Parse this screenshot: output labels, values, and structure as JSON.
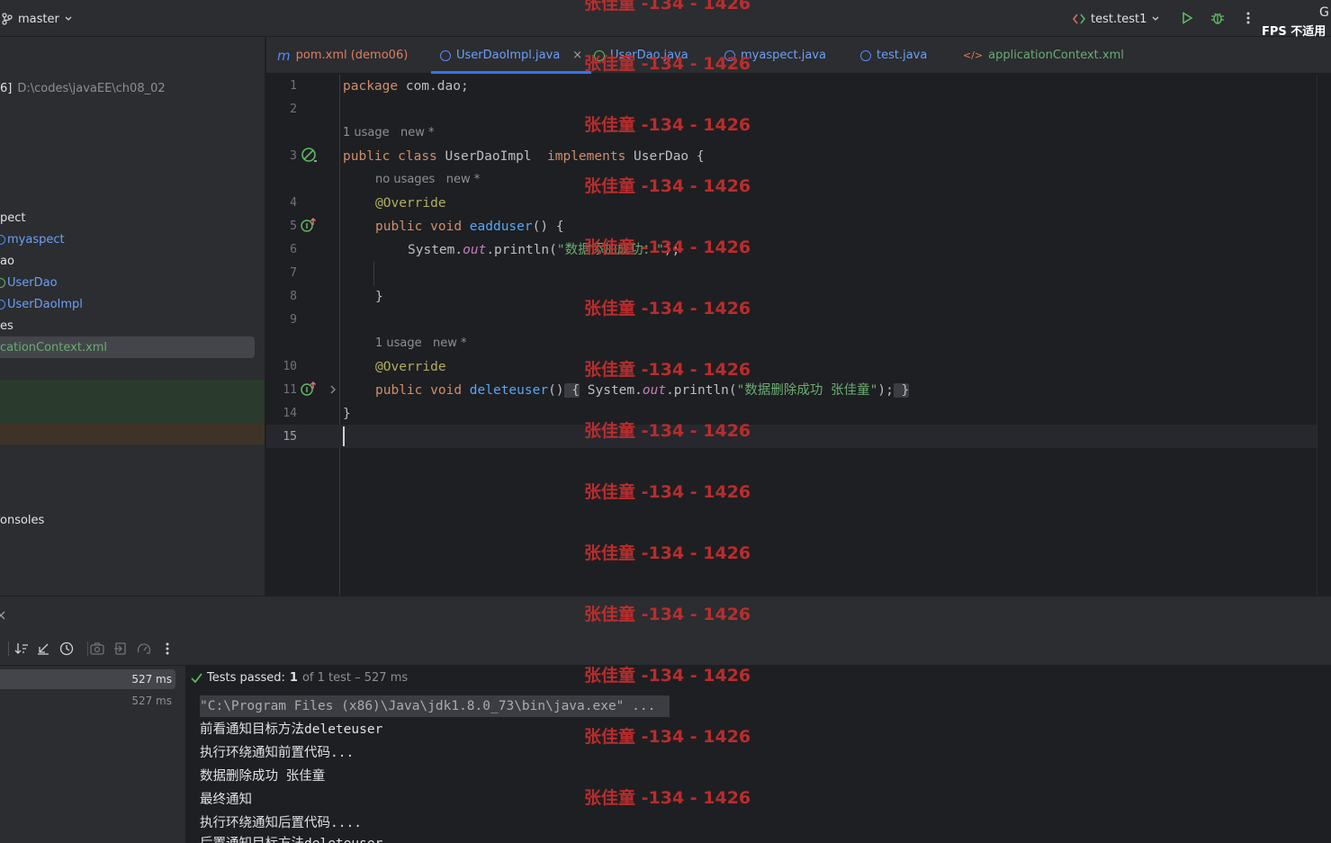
{
  "topbar": {
    "branch": "master",
    "run_config": "test.test1",
    "fps_label": "FPS 不适用",
    "fps_symbol": "G"
  },
  "project": {
    "rows": [
      {
        "label": "6]",
        "path": "D:\\codes\\javaEE\\ch08_02"
      },
      {
        "label": "pect"
      },
      {
        "label": "myaspect"
      },
      {
        "label": "ao"
      },
      {
        "label": "UserDao"
      },
      {
        "label": "UserDaoImpl"
      },
      {
        "label": "es"
      },
      {
        "label": "cationContext.xml"
      },
      {
        "label": "onsoles"
      }
    ]
  },
  "tabs": [
    {
      "prefix": "m",
      "label": "pom.xml (demo06)"
    },
    {
      "label": "UserDaoImpl.java",
      "close": "×"
    },
    {
      "label": "UserDao.java"
    },
    {
      "label": "myaspect.java"
    },
    {
      "label": "test.java"
    },
    {
      "prefix": "</>",
      "label": "applicationContext.xml"
    }
  ],
  "editor": {
    "line_numbers": [
      "1",
      "2",
      "3",
      "4",
      "5",
      "6",
      "7",
      "8",
      "9",
      "10",
      "11",
      "14",
      "15"
    ],
    "hints": {
      "class_usage": "1 usage   new *",
      "eadduser_usage": "no usages   new *",
      "deleteuser_usage": "1 usage   new *"
    },
    "code": {
      "l1_kw": "package",
      "l1_rest": " com.dao;",
      "l3_kw1": "public",
      "l3_kw2": "class",
      "l3_name": " UserDaoImpl  ",
      "l3_kw3": "implements",
      "l3_rest": " UserDao {",
      "l4_ann": "@Override",
      "l5_kw1": "public",
      "l5_kw2": "void",
      "l5_fn": "eadduser",
      "l5_rest": "() {",
      "l6_sys": "System.",
      "l6_out": "out",
      "l6_call": ".println(",
      "l6_str": "\"数据添加成功：\"",
      "l6_end": ");",
      "l8_brace": "}",
      "l10_ann": "@Override",
      "l11_kw1": "public",
      "l11_kw2": "void",
      "l11_fn": "deleteuser",
      "l11_paren": "()",
      "l11_open": " {",
      "l11_sys": " System.",
      "l11_out": "out",
      "l11_call": ".println(",
      "l11_str": "\"数据删除成功 张佳童\"",
      "l11_end": ");",
      "l11_close": " }",
      "l14_brace": "}"
    }
  },
  "bottom": {
    "tests": {
      "time1": "527 ms",
      "time2": "527 ms"
    },
    "status": {
      "passed": "Tests passed:",
      "count": "1",
      "detail": "of 1 test – 527 ms"
    },
    "console_lines": [
      "\"C:\\Program Files (x86)\\Java\\jdk1.8.0_73\\bin\\java.exe\" ...",
      "前看通知目标方法deleteuser",
      "执行环绕通知前置代码...",
      "数据删除成功 张佳童",
      "最终通知",
      "执行环绕通知后置代码....",
      "后置通知目标方法deleteuser"
    ]
  },
  "watermark": "张佳童 -134 - 1426",
  "colors": {
    "bg": "#1e1f22",
    "panel": "#2b2d30",
    "keyword": "#cf8e6d",
    "string": "#6aab73",
    "function": "#56a8f5",
    "annotation": "#b3ae60",
    "watermark": "#c62d2d"
  }
}
